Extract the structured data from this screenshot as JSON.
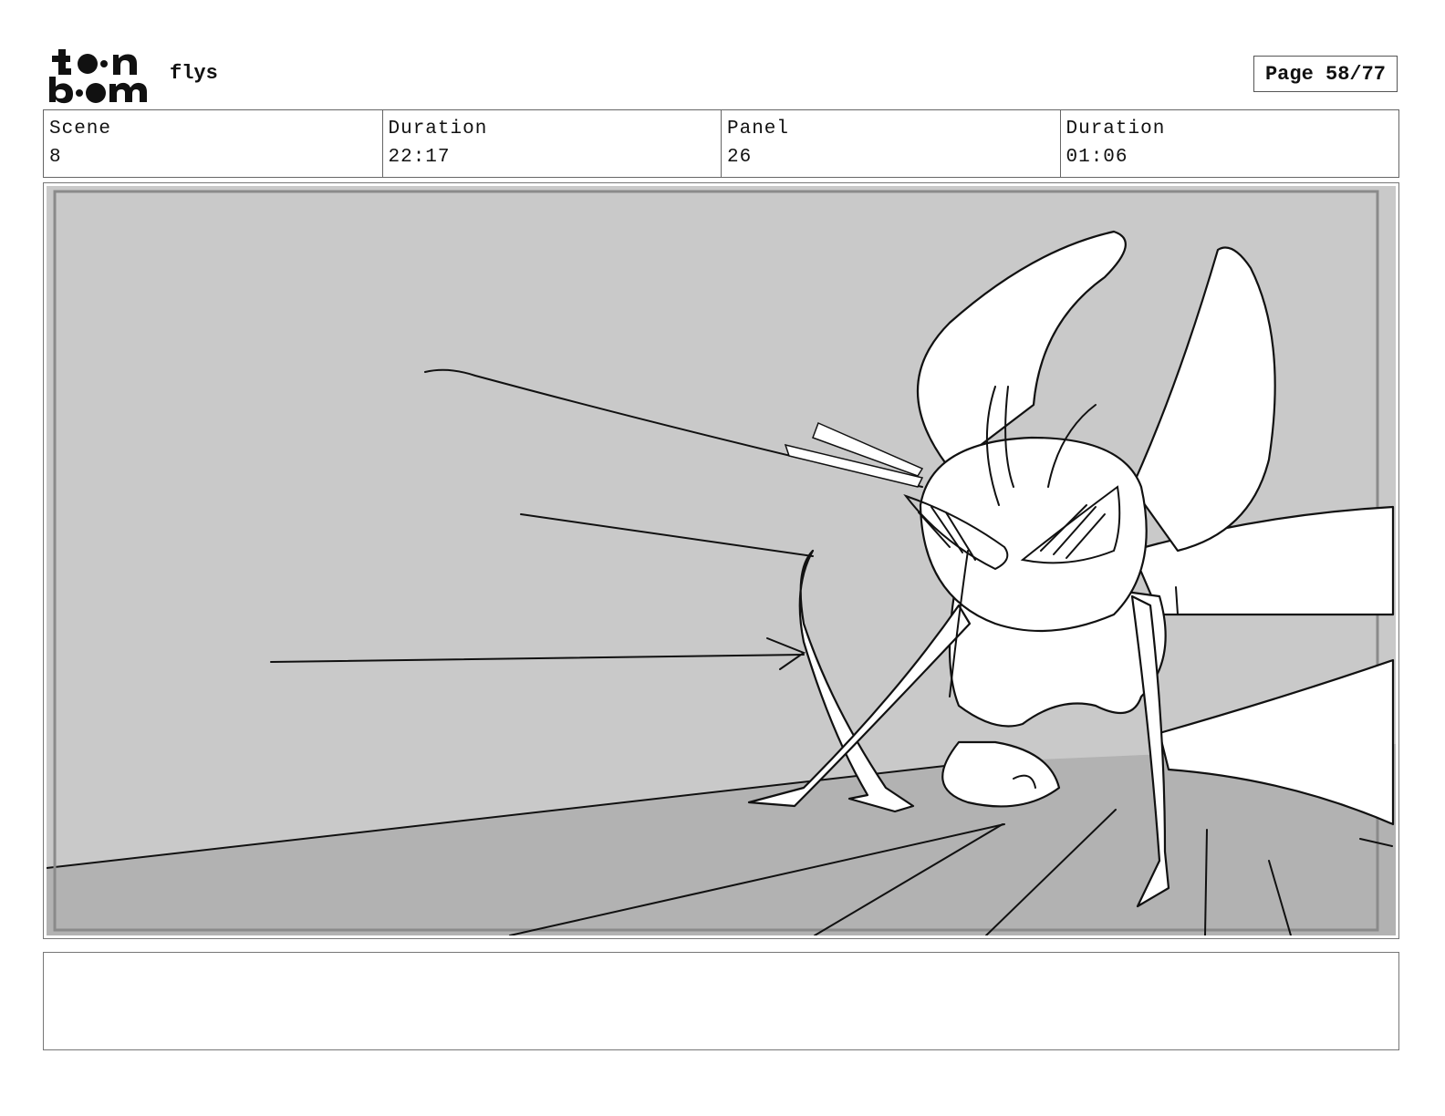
{
  "header": {
    "logo_text_line1": "toon",
    "logo_text_line2": "boom",
    "project_title": "flys",
    "page_number": "Page 58/77"
  },
  "info": [
    {
      "label": "Scene",
      "value": "8"
    },
    {
      "label": "Duration",
      "value": "22:17"
    },
    {
      "label": "Panel",
      "value": "26"
    },
    {
      "label": "Duration",
      "value": "01:06"
    }
  ],
  "notes": {
    "text": ""
  },
  "colors": {
    "wall": "#c9c9c9",
    "floor": "#b2b2b2",
    "line": "#111111",
    "figure": "#ffffff"
  }
}
